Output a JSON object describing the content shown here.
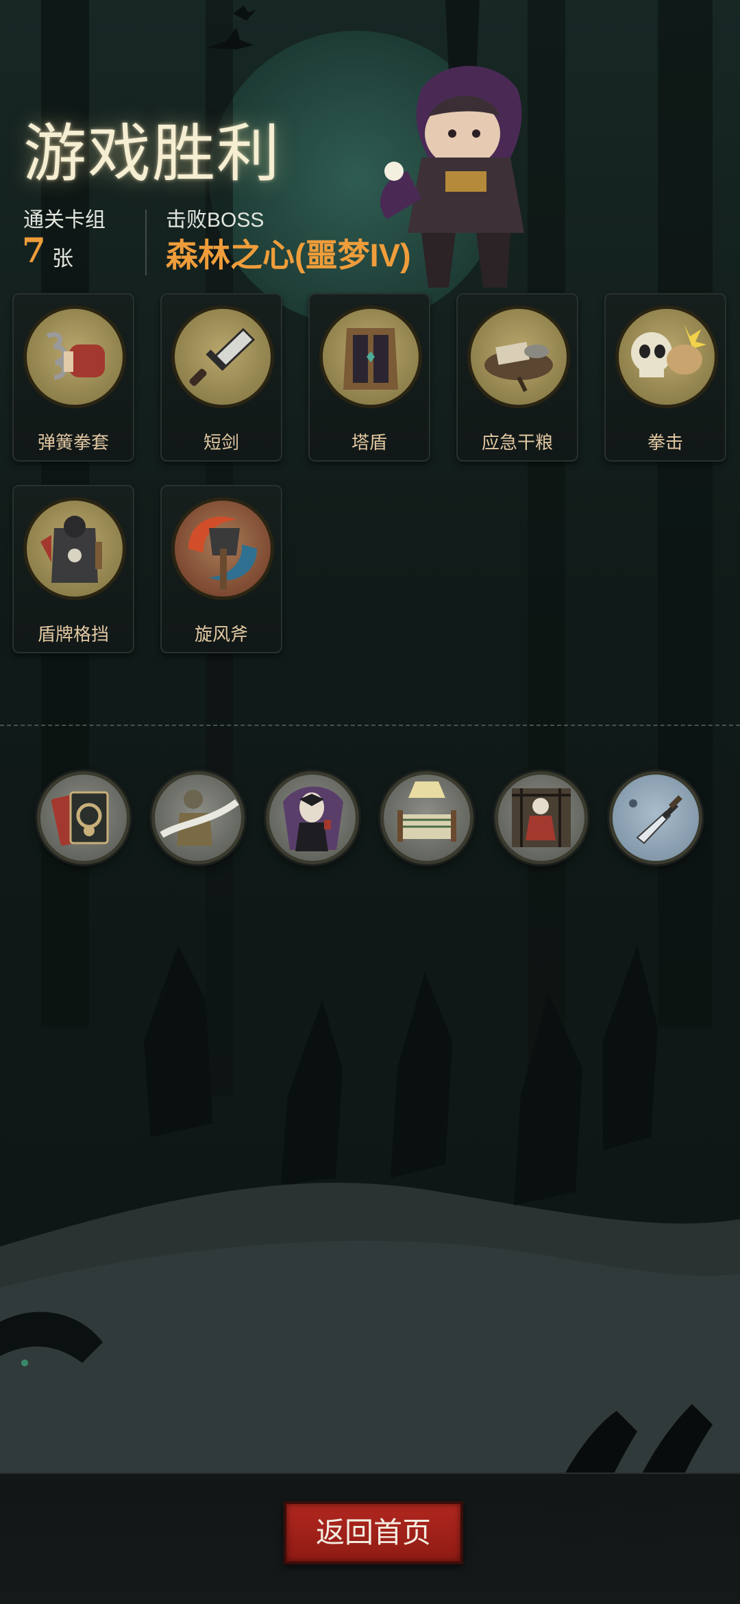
{
  "header": {
    "title": "游戏胜利",
    "deck_label": "通关卡组",
    "deck_count": "7",
    "deck_unit": "张",
    "boss_label": "击败BOSS",
    "boss_name": "森林之心(噩梦IV)"
  },
  "cards": [
    {
      "name": "弹簧拳套",
      "icon": "spring-glove-icon"
    },
    {
      "name": "短剑",
      "icon": "short-sword-icon"
    },
    {
      "name": "塔盾",
      "icon": "tower-shield-icon"
    },
    {
      "name": "应急干粮",
      "icon": "emergency-rations-icon"
    },
    {
      "name": "拳击",
      "icon": "punch-icon"
    },
    {
      "name": "盾牌格挡",
      "icon": "shield-block-icon"
    },
    {
      "name": "旋风斧",
      "icon": "whirlwind-axe-icon"
    }
  ],
  "relics": [
    {
      "icon": "skull-card-icon"
    },
    {
      "icon": "warrior-slash-icon"
    },
    {
      "icon": "vampire-icon"
    },
    {
      "icon": "boxing-ring-icon"
    },
    {
      "icon": "girl-in-cage-icon"
    },
    {
      "icon": "dagger-icon"
    }
  ],
  "footer": {
    "home_button": "返回首页"
  },
  "colors": {
    "accent": "#ef9d3b",
    "title": "#f5eed2",
    "card_label": "#e2c8a2",
    "button": "#a3221a"
  }
}
